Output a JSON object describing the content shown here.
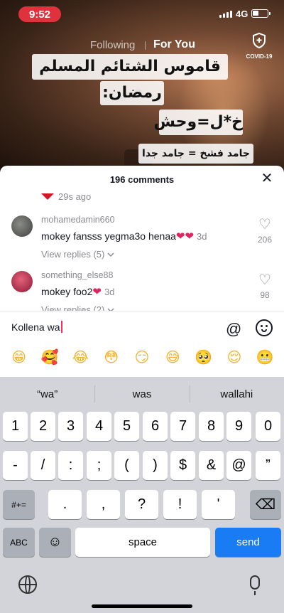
{
  "status_bar": {
    "time": "9:52",
    "network": "4G"
  },
  "top_nav": {
    "following": "Following",
    "for_you": "For You",
    "covid_label": "COVID-19"
  },
  "video_overlay": {
    "line1": "قاموس الشتائم المسلم في",
    "line2": "رمضان:",
    "line3": "خ*ل=وحش",
    "line4": "جامد فشخ = جامد جدا"
  },
  "comments_panel": {
    "title": "196 comments",
    "previous_time": "29s ago",
    "comments": [
      {
        "username": "mohamedamin660",
        "text": "mokey fansss yegma3o henaa",
        "hearts": "❤❤",
        "ago": "3d",
        "replies": "View replies (5)",
        "likes": "206"
      },
      {
        "username": "something_else88",
        "text": "mokey foo2",
        "hearts": "❤",
        "ago": "3d",
        "replies": "View replies (2)",
        "likes": "98"
      }
    ]
  },
  "comment_input": {
    "value": "Kollena wa",
    "at_icon": "@"
  },
  "emoji_bar": [
    "😁",
    "🥰",
    "😂",
    "😳",
    "😏",
    "😅",
    "🥺",
    "😌",
    "😬"
  ],
  "keyboard": {
    "suggestions": [
      "“wa”",
      "was",
      "wallahi"
    ],
    "row1": [
      "1",
      "2",
      "3",
      "4",
      "5",
      "6",
      "7",
      "8",
      "9",
      "0"
    ],
    "row2": [
      "-",
      "/",
      ":",
      ";",
      "(",
      ")",
      "$",
      "&",
      "@",
      "”"
    ],
    "row3": [
      ".",
      ",",
      "?",
      "!",
      "'"
    ],
    "shift_label": "#+=",
    "abc_label": "ABC",
    "space_label": "space",
    "send_label": "send",
    "delete_icon": "⌫",
    "emoji_key_icon": "☺"
  },
  "colors": {
    "send": "#1a7cf5",
    "caret": "#fe2c55",
    "time_pill": "#e0323c"
  }
}
